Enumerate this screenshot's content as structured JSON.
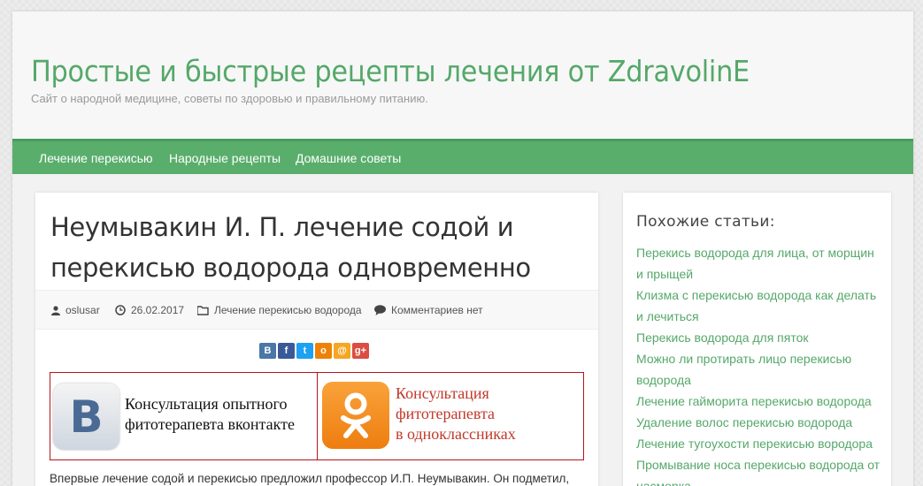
{
  "header": {
    "title": "Простые и быстрые рецепты лечения от ZdravolinE",
    "description": "Сайт о народной медицине, советы по здоровью и правильному питанию."
  },
  "nav": {
    "items": [
      {
        "label": "Лечение перекисью"
      },
      {
        "label": "Народные рецепты"
      },
      {
        "label": "Домашние советы"
      }
    ]
  },
  "post": {
    "title": "Неумывакин И. П. лечение содой и перекисью водорода одновременно",
    "author": "oslusar",
    "date": "26.02.2017",
    "category": "Лечение перекисью водорода",
    "comments": "Комментариев нет",
    "share": [
      {
        "icon": "vk-icon",
        "glyph": "В",
        "color": "#4a76a8"
      },
      {
        "icon": "facebook-icon",
        "glyph": "f",
        "color": "#3b5998"
      },
      {
        "icon": "twitter-icon",
        "glyph": "t",
        "color": "#1da1f2"
      },
      {
        "icon": "odnoklassniki-icon",
        "glyph": "о",
        "color": "#ee8208"
      },
      {
        "icon": "mail-icon",
        "glyph": "@",
        "color": "#f5a623"
      },
      {
        "icon": "google-plus-icon",
        "glyph": "g+",
        "color": "#dc4e41"
      }
    ],
    "consult_vk": "Консультация опытного фитотерапевта вконтакте",
    "consult_ok_line1": "Консультация",
    "consult_ok_line2": "фитотерапевта",
    "consult_ok_line3": "в одноклассниках",
    "intro": "Впервые лечение содой и перекисью предложил профессор И.П. Неумывакин. Он подметил,"
  },
  "sidebar": {
    "title": "Похожие статьи:",
    "items": [
      {
        "label": "Перекись водорода для лица, от морщин и прыщей"
      },
      {
        "label": "Клизма с перекисью водорода как делать и лечиться"
      },
      {
        "label": "Перекись водорода для пяток"
      },
      {
        "label": "Можно ли протирать лицо перекисью водорода"
      },
      {
        "label": "Лечение гайморита перекисью водорода"
      },
      {
        "label": "Удаление волос перекисью водорода"
      },
      {
        "label": "Лечение тугоухости перекисью вородора"
      },
      {
        "label": "Промывание носа перекисью водорода от насморка"
      }
    ]
  },
  "colors": {
    "accent": "#55a869",
    "nav_bg": "#5aae6c",
    "consult_border": "#b5151b",
    "ok_text": "#c0392b"
  }
}
